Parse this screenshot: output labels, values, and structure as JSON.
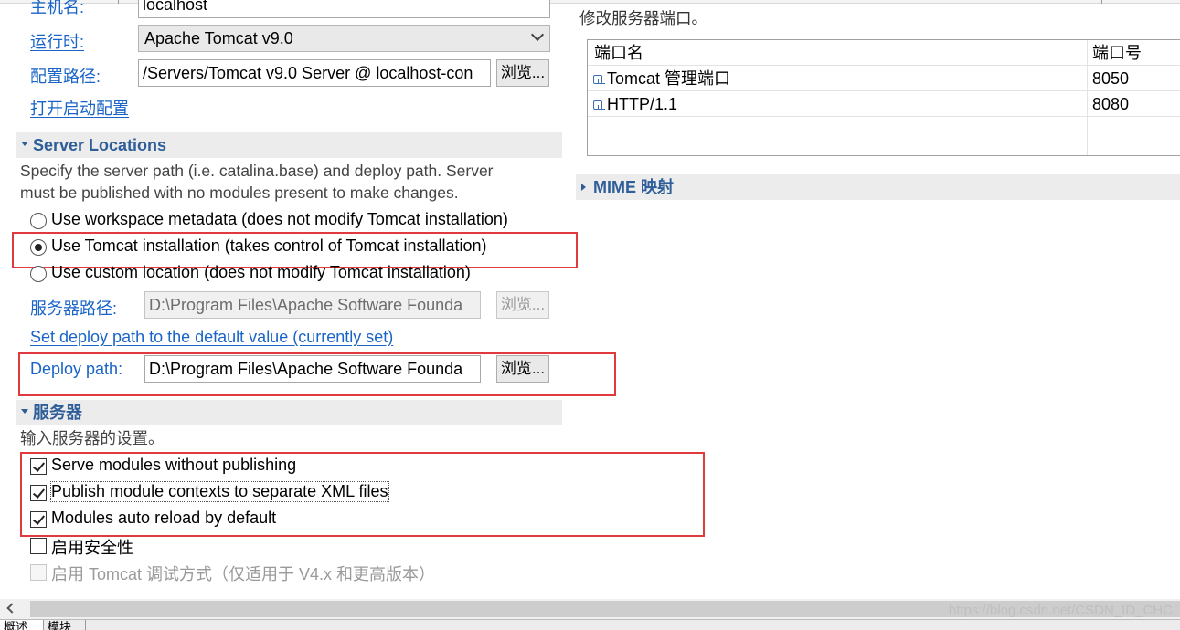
{
  "general": {
    "hostname_label": "主机名:",
    "hostname_value": "localhost",
    "runtime_label": "运行时:",
    "runtime_value": "Apache Tomcat v9.0",
    "config_path_label": "配置路径:",
    "config_path_value": "/Servers/Tomcat v9.0 Server @ localhost-con",
    "browse_label": "浏览...",
    "open_launch_config": "打开启动配置"
  },
  "server_locations": {
    "title": "Server Locations",
    "description_line1": "Specify the server path (i.e. catalina.base) and deploy path. Server",
    "description_line2": "must be published with no modules present to make changes.",
    "options": [
      {
        "label": "Use workspace metadata (does not modify Tomcat installation)",
        "selected": false
      },
      {
        "label": "Use Tomcat installation (takes control of Tomcat installation)",
        "selected": true
      },
      {
        "label": "Use custom location (does not modify Tomcat installation)",
        "selected": false
      }
    ],
    "server_path_label": "服务器路径:",
    "server_path_value": "D:\\Program Files\\Apache Software Founda",
    "server_path_browse": "浏览...",
    "set_default_link": "Set deploy path to the default value (currently set)",
    "deploy_path_label": "Deploy path:",
    "deploy_path_value": "D:\\Program Files\\Apache Software Founda",
    "deploy_path_browse": "浏览..."
  },
  "server_options": {
    "title": "服务器",
    "description": "输入服务器的设置。",
    "checkboxes": [
      {
        "label": "Serve modules without publishing",
        "checked": true,
        "enabled": true
      },
      {
        "label": "Publish module contexts to separate XML files",
        "checked": true,
        "enabled": true
      },
      {
        "label": "Modules auto reload by default",
        "checked": true,
        "enabled": true
      },
      {
        "label": "启用安全性",
        "checked": false,
        "enabled": true
      },
      {
        "label": "启用 Tomcat 调试方式（仅适用于 V4.x 和更高版本）",
        "checked": false,
        "enabled": false
      }
    ]
  },
  "ports": {
    "description": "修改服务器端口。",
    "columns": [
      "端口名",
      "端口号"
    ],
    "rows": [
      {
        "name": "Tomcat 管理端口",
        "port": "8050"
      },
      {
        "name": "HTTP/1.1",
        "port": "8080"
      }
    ]
  },
  "mime": {
    "title": "MIME 映射"
  },
  "footer": {
    "tabs": [
      "概述",
      "模块"
    ],
    "watermark": "https://blog.csdn.net/CSDN_ID_CHC"
  },
  "colors": {
    "label_blue": "#1a64c8",
    "section_title": "#2f5e99",
    "highlight_red": "#e0393e"
  }
}
